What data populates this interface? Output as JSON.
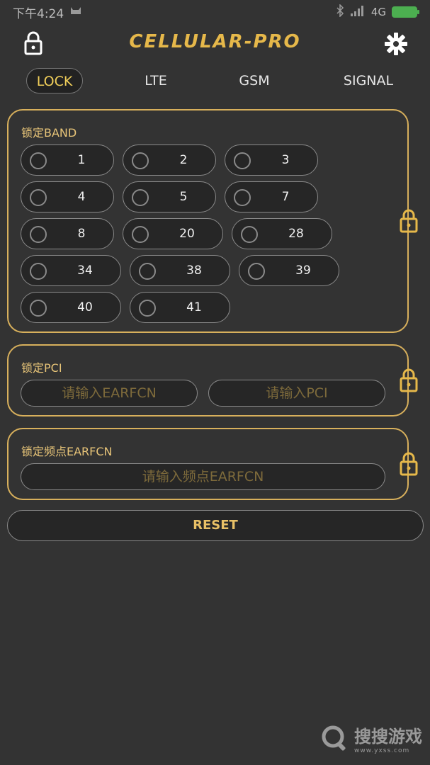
{
  "status_bar": {
    "time": "下午4:24",
    "network": "4G"
  },
  "header": {
    "title": "CELLULAR-PRO"
  },
  "tabs": [
    {
      "label": "LOCK",
      "active": true
    },
    {
      "label": "LTE",
      "active": false
    },
    {
      "label": "GSM",
      "active": false
    },
    {
      "label": "SIGNAL",
      "active": false
    }
  ],
  "band_panel": {
    "title": "锁定BAND",
    "bands": [
      "1",
      "2",
      "3",
      "4",
      "5",
      "7",
      "8",
      "20",
      "28",
      "34",
      "38",
      "39",
      "40",
      "41"
    ]
  },
  "pci_panel": {
    "title": "锁定PCI",
    "earfcn_placeholder": "请输入EARFCN",
    "pci_placeholder": "请输入PCI"
  },
  "earfcn_panel": {
    "title": "锁定频点EARFCN",
    "earfcn_placeholder": "请输入频点EARFCN"
  },
  "reset_label": "RESET",
  "watermark": {
    "text": "搜搜游戏",
    "subtext": "www.yxss.com"
  },
  "colors": {
    "accent": "#e6b84a",
    "background": "#333333",
    "panel_border": "#d8b05c"
  }
}
